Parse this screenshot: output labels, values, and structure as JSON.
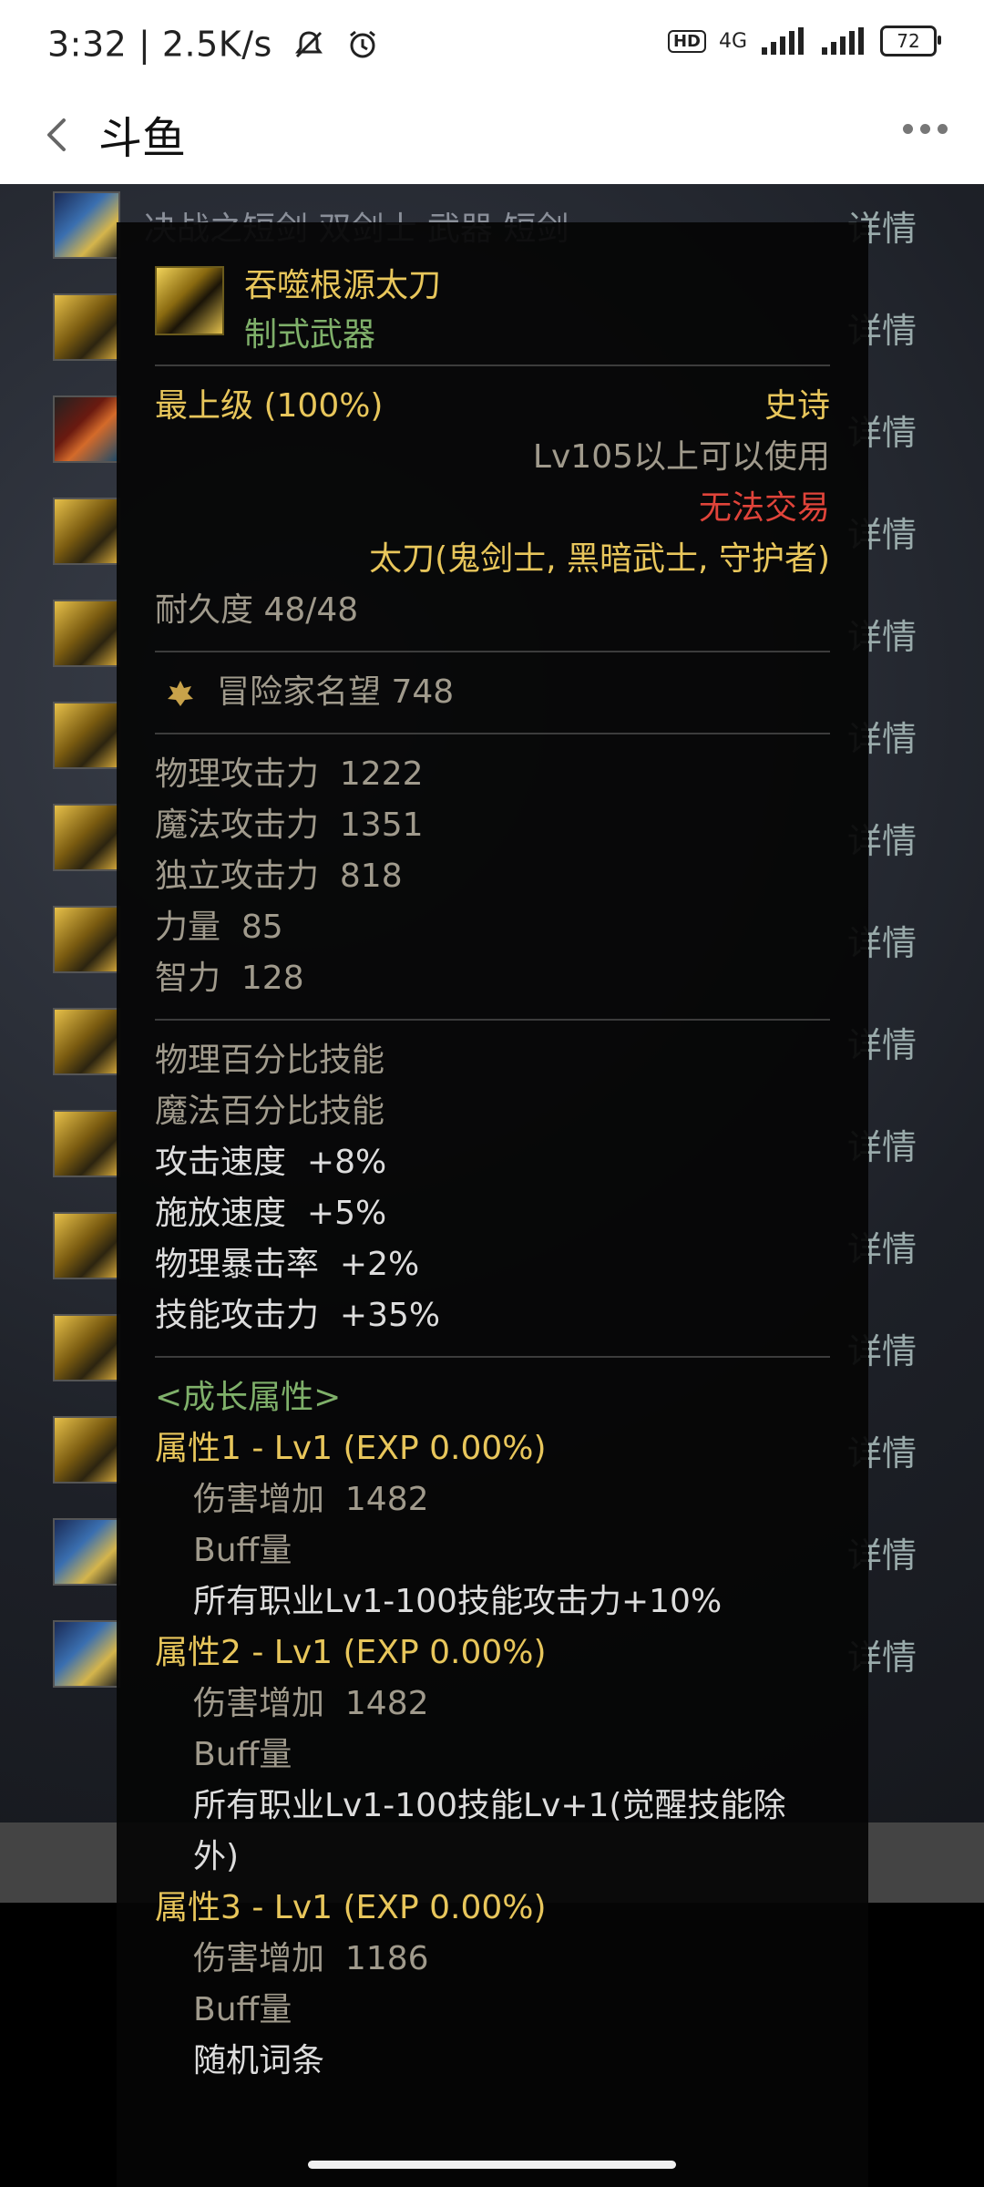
{
  "status_bar": {
    "time": "3:32",
    "speed": "2.5K/s",
    "hd": "HD",
    "network": "4G",
    "battery": "72"
  },
  "nav": {
    "title": "斗鱼"
  },
  "background_list": {
    "first_row_text": "决战之短剑 双剑士  武器  短剑",
    "detail_label": "详情",
    "row_count": 15
  },
  "item": {
    "name": "吞噬根源太刀",
    "type": "制式武器",
    "grade": "最上级",
    "grade_pct": "(100%)",
    "rarity": "史诗",
    "level_req": "Lv105以上可以使用",
    "trade": "无法交易",
    "class_req": "太刀(鬼剑士, 黑暗武士, 守护者)",
    "durability": "耐久度 48/48",
    "reputation": "冒险家名望 748",
    "stats": [
      {
        "label": "物理攻击力",
        "value": "1222"
      },
      {
        "label": "魔法攻击力",
        "value": "1351"
      },
      {
        "label": "独立攻击力",
        "value": "818"
      },
      {
        "label": "力量",
        "value": "85"
      },
      {
        "label": "智力",
        "value": "128"
      }
    ],
    "skills": {
      "phys_pct": "物理百分比技能",
      "mag_pct": "魔法百分比技能"
    },
    "bonuses": [
      {
        "label": "攻击速度",
        "value": "+8%"
      },
      {
        "label": "施放速度",
        "value": "+5%"
      },
      {
        "label": "物理暴击率",
        "value": "+2%"
      },
      {
        "label": "技能攻击力",
        "value": "+35%"
      }
    ],
    "growth_title": "<成长属性>",
    "growth": [
      {
        "title": "属性1 - Lv1 (EXP 0.00%)",
        "dmg_label": "伤害增加",
        "dmg_value": "1482",
        "buff": "Buff量",
        "effect": "所有职业Lv1-100技能攻击力+10%"
      },
      {
        "title": "属性2 - Lv1 (EXP 0.00%)",
        "dmg_label": "伤害增加",
        "dmg_value": "1482",
        "buff": "Buff量",
        "effect_line1": "所有职业Lv1-100技能Lv+1(觉醒技能除",
        "effect_line2": "外)"
      },
      {
        "title": "属性3 - Lv1 (EXP 0.00%)",
        "dmg_label": "伤害增加",
        "dmg_value": "1186",
        "buff": "Buff量",
        "effect": "随机词条"
      }
    ]
  },
  "colors": {
    "gold": "#e8c65b",
    "green": "#7fb06a",
    "red": "#e0443a"
  }
}
